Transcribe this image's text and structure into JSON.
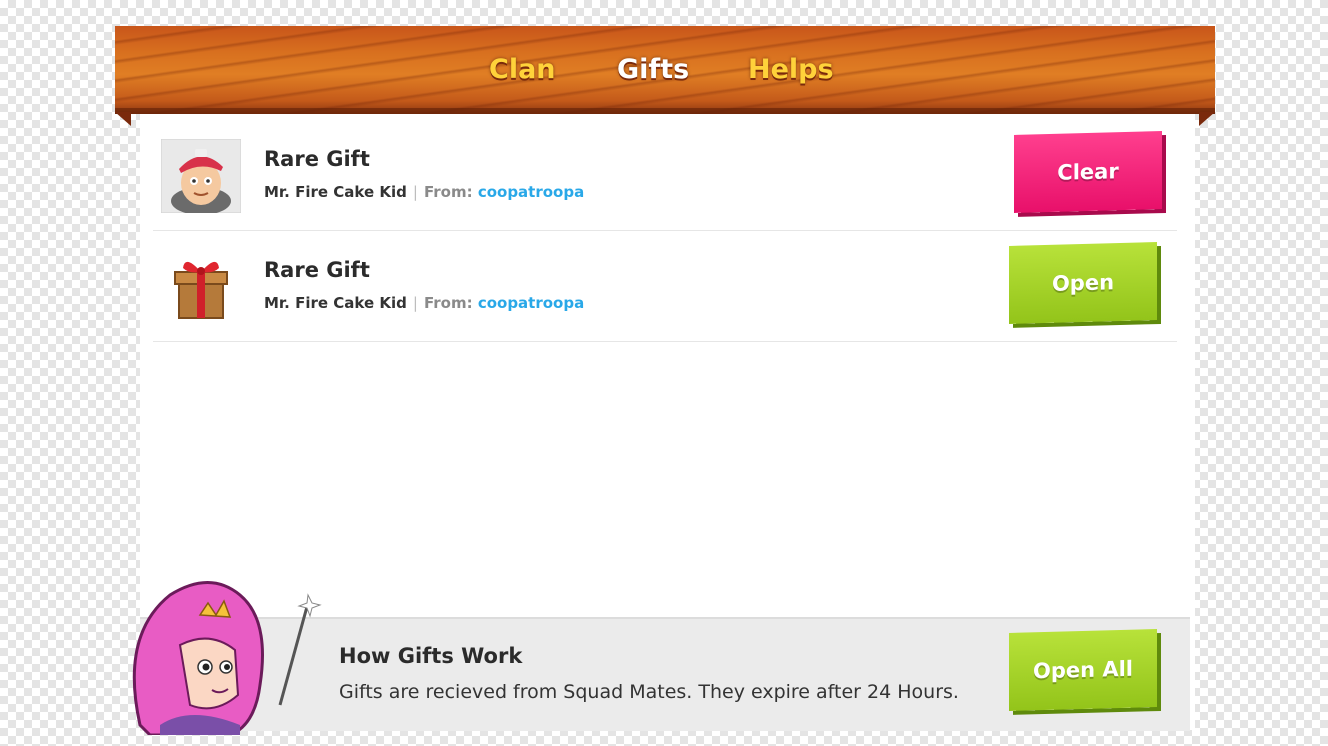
{
  "tabs": [
    {
      "label": "Clan",
      "color": "#ffd23a"
    },
    {
      "label": "Gifts",
      "color": "#ffffff",
      "active": true
    },
    {
      "label": "Helps",
      "color": "#ffd23a"
    }
  ],
  "gifts": [
    {
      "title": "Rare Gift",
      "item": "Mr. Fire Cake Kid",
      "from_label": "From:",
      "from_user": "coopatroopa",
      "action": "Clear",
      "thumbnail": "character-portrait"
    },
    {
      "title": "Rare Gift",
      "item": "Mr. Fire Cake Kid",
      "from_label": "From:",
      "from_user": "coopatroopa",
      "action": "Open",
      "thumbnail": "gift-box-icon"
    }
  ],
  "footer": {
    "title": "How Gifts Work",
    "text": "Gifts are recieved from Squad Mates. They expire after 24 Hours.",
    "open_all_label": "Open All"
  },
  "colors": {
    "clear_button": "#e8106a",
    "open_button": "#93c41a",
    "link": "#29a8e8",
    "wood": "#d8701f"
  }
}
